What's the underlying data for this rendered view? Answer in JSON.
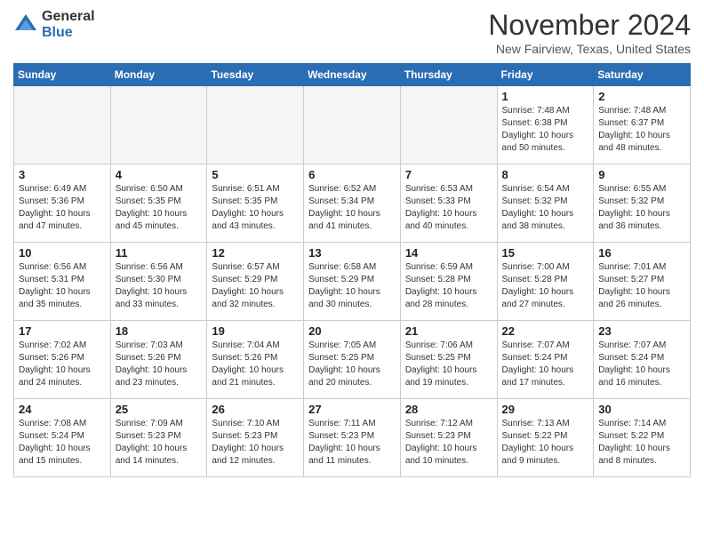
{
  "header": {
    "logo_general": "General",
    "logo_blue": "Blue",
    "month_year": "November 2024",
    "location": "New Fairview, Texas, United States"
  },
  "weekdays": [
    "Sunday",
    "Monday",
    "Tuesday",
    "Wednesday",
    "Thursday",
    "Friday",
    "Saturday"
  ],
  "weeks": [
    [
      {
        "day": "",
        "info": ""
      },
      {
        "day": "",
        "info": ""
      },
      {
        "day": "",
        "info": ""
      },
      {
        "day": "",
        "info": ""
      },
      {
        "day": "",
        "info": ""
      },
      {
        "day": "1",
        "info": "Sunrise: 7:48 AM\nSunset: 6:38 PM\nDaylight: 10 hours\nand 50 minutes."
      },
      {
        "day": "2",
        "info": "Sunrise: 7:48 AM\nSunset: 6:37 PM\nDaylight: 10 hours\nand 48 minutes."
      }
    ],
    [
      {
        "day": "3",
        "info": "Sunrise: 6:49 AM\nSunset: 5:36 PM\nDaylight: 10 hours\nand 47 minutes."
      },
      {
        "day": "4",
        "info": "Sunrise: 6:50 AM\nSunset: 5:35 PM\nDaylight: 10 hours\nand 45 minutes."
      },
      {
        "day": "5",
        "info": "Sunrise: 6:51 AM\nSunset: 5:35 PM\nDaylight: 10 hours\nand 43 minutes."
      },
      {
        "day": "6",
        "info": "Sunrise: 6:52 AM\nSunset: 5:34 PM\nDaylight: 10 hours\nand 41 minutes."
      },
      {
        "day": "7",
        "info": "Sunrise: 6:53 AM\nSunset: 5:33 PM\nDaylight: 10 hours\nand 40 minutes."
      },
      {
        "day": "8",
        "info": "Sunrise: 6:54 AM\nSunset: 5:32 PM\nDaylight: 10 hours\nand 38 minutes."
      },
      {
        "day": "9",
        "info": "Sunrise: 6:55 AM\nSunset: 5:32 PM\nDaylight: 10 hours\nand 36 minutes."
      }
    ],
    [
      {
        "day": "10",
        "info": "Sunrise: 6:56 AM\nSunset: 5:31 PM\nDaylight: 10 hours\nand 35 minutes."
      },
      {
        "day": "11",
        "info": "Sunrise: 6:56 AM\nSunset: 5:30 PM\nDaylight: 10 hours\nand 33 minutes."
      },
      {
        "day": "12",
        "info": "Sunrise: 6:57 AM\nSunset: 5:29 PM\nDaylight: 10 hours\nand 32 minutes."
      },
      {
        "day": "13",
        "info": "Sunrise: 6:58 AM\nSunset: 5:29 PM\nDaylight: 10 hours\nand 30 minutes."
      },
      {
        "day": "14",
        "info": "Sunrise: 6:59 AM\nSunset: 5:28 PM\nDaylight: 10 hours\nand 28 minutes."
      },
      {
        "day": "15",
        "info": "Sunrise: 7:00 AM\nSunset: 5:28 PM\nDaylight: 10 hours\nand 27 minutes."
      },
      {
        "day": "16",
        "info": "Sunrise: 7:01 AM\nSunset: 5:27 PM\nDaylight: 10 hours\nand 26 minutes."
      }
    ],
    [
      {
        "day": "17",
        "info": "Sunrise: 7:02 AM\nSunset: 5:26 PM\nDaylight: 10 hours\nand 24 minutes."
      },
      {
        "day": "18",
        "info": "Sunrise: 7:03 AM\nSunset: 5:26 PM\nDaylight: 10 hours\nand 23 minutes."
      },
      {
        "day": "19",
        "info": "Sunrise: 7:04 AM\nSunset: 5:26 PM\nDaylight: 10 hours\nand 21 minutes."
      },
      {
        "day": "20",
        "info": "Sunrise: 7:05 AM\nSunset: 5:25 PM\nDaylight: 10 hours\nand 20 minutes."
      },
      {
        "day": "21",
        "info": "Sunrise: 7:06 AM\nSunset: 5:25 PM\nDaylight: 10 hours\nand 19 minutes."
      },
      {
        "day": "22",
        "info": "Sunrise: 7:07 AM\nSunset: 5:24 PM\nDaylight: 10 hours\nand 17 minutes."
      },
      {
        "day": "23",
        "info": "Sunrise: 7:07 AM\nSunset: 5:24 PM\nDaylight: 10 hours\nand 16 minutes."
      }
    ],
    [
      {
        "day": "24",
        "info": "Sunrise: 7:08 AM\nSunset: 5:24 PM\nDaylight: 10 hours\nand 15 minutes."
      },
      {
        "day": "25",
        "info": "Sunrise: 7:09 AM\nSunset: 5:23 PM\nDaylight: 10 hours\nand 14 minutes."
      },
      {
        "day": "26",
        "info": "Sunrise: 7:10 AM\nSunset: 5:23 PM\nDaylight: 10 hours\nand 12 minutes."
      },
      {
        "day": "27",
        "info": "Sunrise: 7:11 AM\nSunset: 5:23 PM\nDaylight: 10 hours\nand 11 minutes."
      },
      {
        "day": "28",
        "info": "Sunrise: 7:12 AM\nSunset: 5:23 PM\nDaylight: 10 hours\nand 10 minutes."
      },
      {
        "day": "29",
        "info": "Sunrise: 7:13 AM\nSunset: 5:22 PM\nDaylight: 10 hours\nand 9 minutes."
      },
      {
        "day": "30",
        "info": "Sunrise: 7:14 AM\nSunset: 5:22 PM\nDaylight: 10 hours\nand 8 minutes."
      }
    ]
  ]
}
